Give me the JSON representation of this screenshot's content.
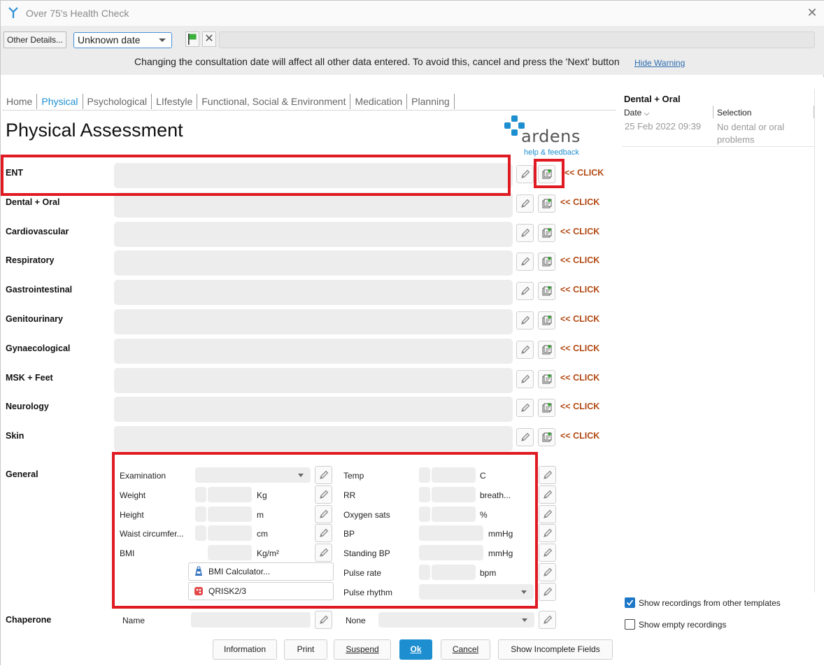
{
  "window": {
    "title": "Over 75's Health Check",
    "close_glyph": "✕"
  },
  "toolbar": {
    "other_details_label": "Other Details...",
    "date_value": "Unknown date",
    "clear_glyph": "✕",
    "warning": "Changing the consultation date will affect all other data entered. To avoid this, cancel and press the 'Next' button",
    "hide_warning": "Hide Warning"
  },
  "tabs": [
    {
      "label": "Home"
    },
    {
      "label": "Physical"
    },
    {
      "label": "Psychological"
    },
    {
      "label": "LIfestyle"
    },
    {
      "label": "Functional, Social & Environment"
    },
    {
      "label": "Medication"
    },
    {
      "label": "Planning"
    }
  ],
  "page": {
    "title": "Physical Assessment",
    "brand": "ardens",
    "help": "help & feedback",
    "click_label": "<< CLICK"
  },
  "rows": [
    {
      "label": "ENT"
    },
    {
      "label": "Dental + Oral"
    },
    {
      "label": "Cardiovascular"
    },
    {
      "label": "Respiratory"
    },
    {
      "label": "Gastrointestinal"
    },
    {
      "label": "Genitourinary"
    },
    {
      "label": "Gynaecological"
    },
    {
      "label": "MSK + Feet"
    },
    {
      "label": "Neurology"
    },
    {
      "label": "Skin"
    }
  ],
  "general": {
    "label": "General",
    "left": [
      {
        "label": "Examination",
        "unit": ""
      },
      {
        "label": "Weight",
        "unit": "Kg"
      },
      {
        "label": "Height",
        "unit": "m"
      },
      {
        "label": "Waist circumfer...",
        "unit": "cm"
      },
      {
        "label": "BMI",
        "unit": "Kg/m²"
      }
    ],
    "right": [
      {
        "label": "Temp",
        "unit": "C"
      },
      {
        "label": "RR",
        "unit": "breath..."
      },
      {
        "label": "Oxygen sats",
        "unit": "%"
      },
      {
        "label": "BP",
        "unit": "mmHg"
      },
      {
        "label": "Standing BP",
        "unit": "mmHg"
      },
      {
        "label": "Pulse rate",
        "unit": "bpm"
      },
      {
        "label": "Pulse rhythm",
        "unit": ""
      }
    ],
    "bmi_calculator": "BMI Calculator...",
    "qrisk": "QRISK2/3"
  },
  "chaperone": {
    "label": "Chaperone",
    "name_label": "Name",
    "none_label": "None"
  },
  "side": {
    "title": "Dental + Oral",
    "col_date": "Date",
    "col_selection": "Selection",
    "entry_date": "25 Feb 2022 09:39",
    "entry_selection": "No dental or oral problems",
    "show_other": "Show recordings from other templates",
    "show_empty": "Show empty recordings"
  },
  "footer": {
    "information": "Information",
    "print": "Print",
    "suspend": "Suspend",
    "ok": "Ok",
    "cancel": "Cancel",
    "show_incomplete": "Show Incomplete Fields"
  },
  "colors": {
    "accent": "#1d8fd0",
    "highlight": "#e01a22",
    "click": "#b34a14"
  }
}
